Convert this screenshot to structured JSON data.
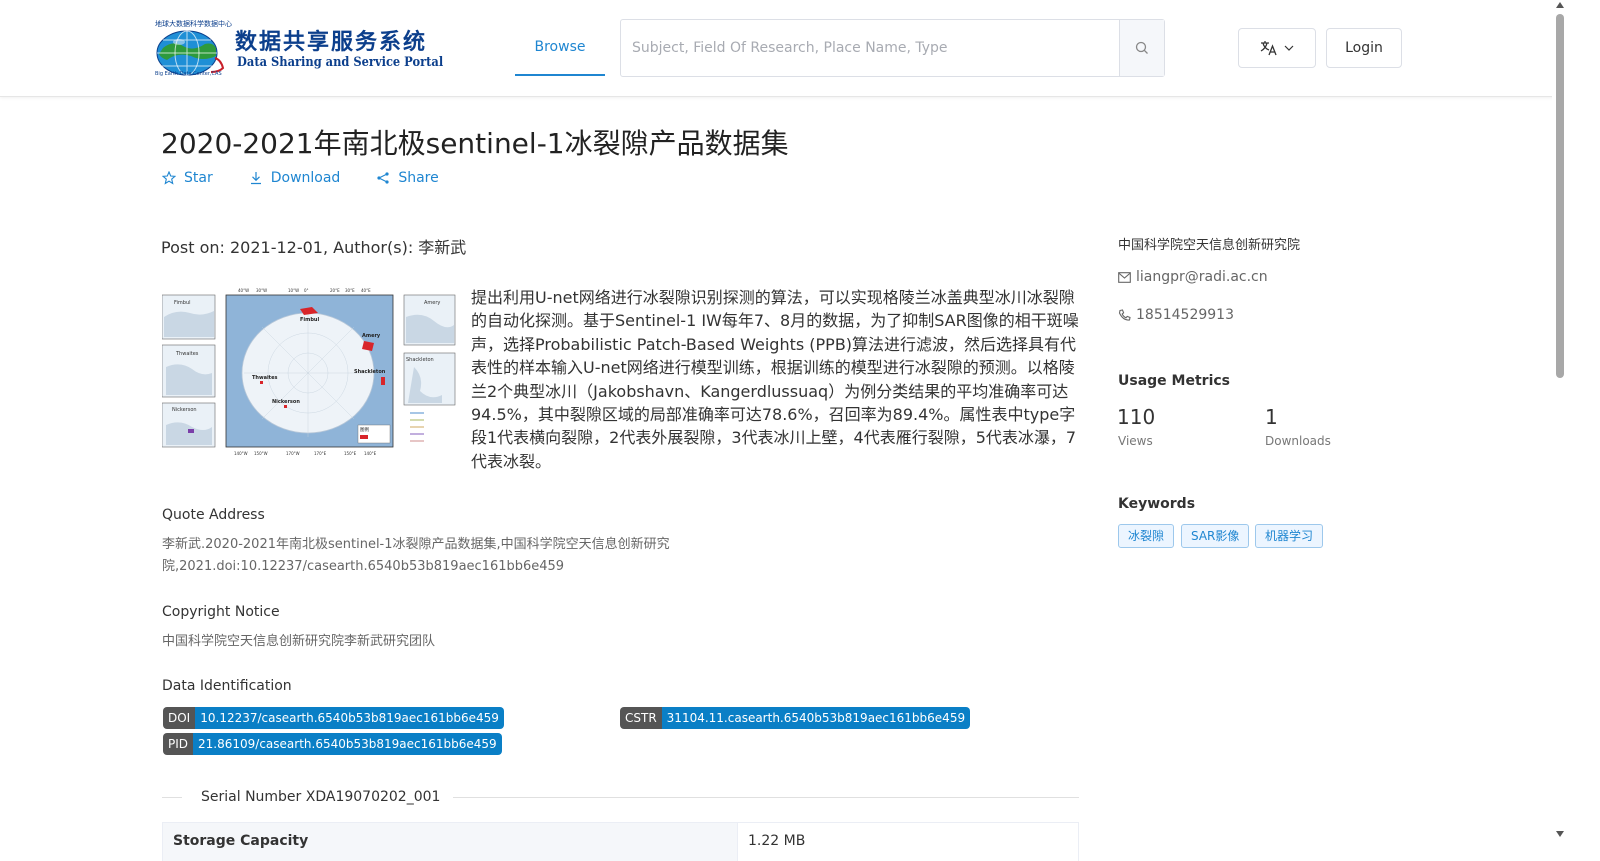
{
  "header": {
    "logo": {
      "title_cn": "数据共享服务系统",
      "title_en": "Data Sharing and Service Portal",
      "arc_text": "地球大数据科学数据中心",
      "sub_text": "Big Earth Data Center,CAS"
    },
    "nav": {
      "browse_label": "Browse"
    },
    "search": {
      "placeholder": "Subject, Field Of Research, Place Name, Type",
      "value": ""
    },
    "login_label": "Login",
    "icons": {
      "search": "search-icon",
      "language": "translate-icon",
      "dropdown": "chevron-down-icon"
    }
  },
  "dataset": {
    "title": "2020-2021年南北极sentinel-1冰裂隙产品数据集",
    "actions": {
      "star": "Star",
      "download": "Download",
      "share": "Share"
    },
    "post_on": "Post on: 2021-12-01, Author(s): 李新武",
    "description": "提出利用U-net网络进行冰裂隙识别探测的算法，可以实现格陵兰冰盖典型冰川冰裂隙的自动化探测。基于Sentinel-1 IW每年7、8月的数据，为了抑制SAR图像的相干斑噪声，选择Probabilistic Patch-Based Weights (PPB)算法进行滤波，然后选择具有代表性的样本输入U-net网络进行模型训练，根据训练的模型进行冰裂隙的预测。以格陵兰2个典型冰川（Jakobshavn、Kangerdlussuaq）为例分类结果的平均准确率可达94.5%，其中裂隙区域的局部准确率可达78.6%，召回率为89.4%。属性表中type字段1代表横向裂隙，2代表外展裂隙，3代表冰川上壁，4代表雁行裂隙，5代表冰瀑，7代表冰裂。",
    "thumbnail": {
      "top_ticks": [
        "40°W",
        "30°W",
        "10°W",
        "0°",
        "20°E",
        "30°E",
        "40°E"
      ],
      "bottom_ticks": [
        "140°W",
        "150°W",
        "170°W",
        "170°E",
        "150°E",
        "140°E"
      ],
      "places": [
        "Fimbul",
        "Amery",
        "Shackleton",
        "Thwaites",
        "Nickerson"
      ],
      "legend_label": "图例"
    },
    "quote": {
      "label": "Quote Address",
      "text": "李新武.2020-2021年南北极sentinel-1冰裂隙产品数据集,中国科学院空天信息创新研究院,2021.doi:10.12237/casearth.6540b53b819aec161bb6e459"
    },
    "copyright": {
      "label": "Copyright Notice",
      "text": "中国科学院空天信息创新研究院李新武研究团队"
    },
    "identification": {
      "label": "Data Identification",
      "doi_key": "DOI",
      "doi_value": "10.12237/casearth.6540b53b819aec161bb6e459",
      "cstr_key": "CSTR",
      "cstr_value": "31104.11.casearth.6540b53b819aec161bb6e459",
      "pid_key": "PID",
      "pid_value": "21.86109/casearth.6540b53b819aec161bb6e459"
    },
    "serial": "Serial Number XDA19070202_001",
    "storage": {
      "key": "Storage Capacity",
      "value": "1.22 MB"
    }
  },
  "sidebar": {
    "org": "中国科学院空天信息创新研究院",
    "email": "liangpr@radi.ac.cn",
    "phone": "18514529913",
    "usage_title": "Usage Metrics",
    "views_count": "110",
    "views_label": "Views",
    "downloads_count": "1",
    "downloads_label": "Downloads",
    "keywords_title": "Keywords",
    "keywords": [
      "冰裂隙",
      "SAR影像",
      "机器学习"
    ]
  },
  "colors": {
    "accent": "#1f86d1",
    "badge_key": "#555555",
    "badge_value": "#0a7fc6",
    "logo": "#0c3f8c"
  }
}
